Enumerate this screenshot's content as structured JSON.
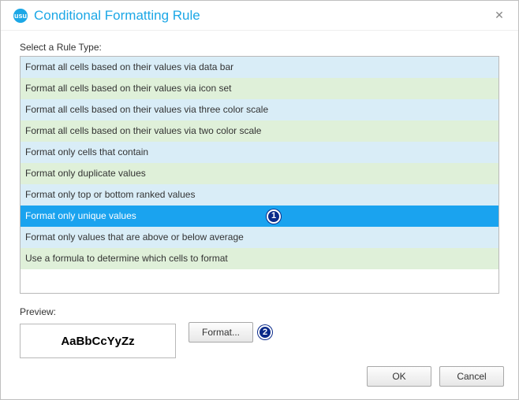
{
  "title": "Conditional Formatting Rule",
  "section_label": "Select a Rule Type:",
  "rule_types": [
    "Format all cells based on their values via data bar",
    "Format all cells based on their values via icon set",
    "Format all cells based on their values via three color scale",
    "Format all cells based on their values via two color scale",
    "Format only cells that contain",
    "Format only duplicate values",
    "Format only top or bottom ranked values",
    "Format only unique values",
    "Format only values that are above or below average",
    "Use a formula to determine which cells to format"
  ],
  "selected_index": 7,
  "callouts": {
    "rule": "1",
    "format": "2"
  },
  "preview_label": "Preview:",
  "preview_sample": "AaBbCcYyZz",
  "format_button": "Format...",
  "ok_button": "OK",
  "cancel_button": "Cancel",
  "icon_label": "usu"
}
